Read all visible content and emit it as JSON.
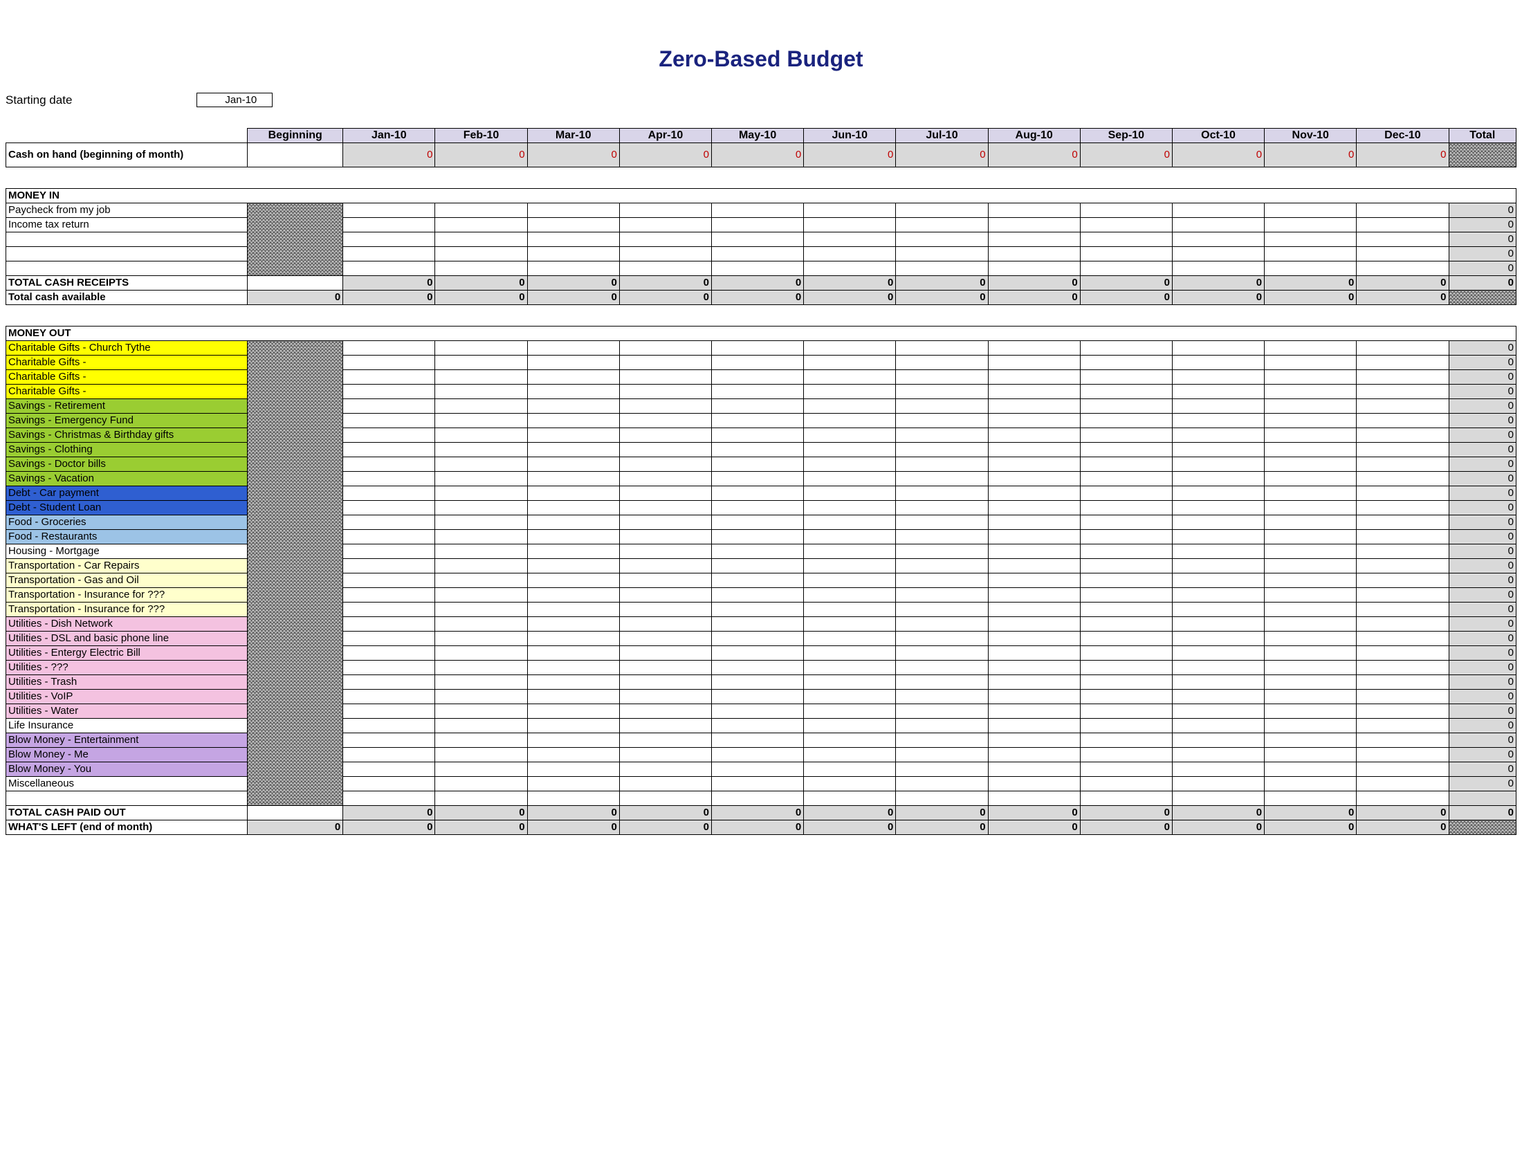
{
  "title": "Zero-Based Budget",
  "start_label": "Starting date",
  "start_value": "Jan-10",
  "columns": [
    "Beginning",
    "Jan-10",
    "Feb-10",
    "Mar-10",
    "Apr-10",
    "May-10",
    "Jun-10",
    "Jul-10",
    "Aug-10",
    "Sep-10",
    "Oct-10",
    "Nov-10",
    "Dec-10",
    "Total"
  ],
  "cash_on_hand_label": "Cash on hand (beginning of month)",
  "cash_on_hand_months": [
    0,
    0,
    0,
    0,
    0,
    0,
    0,
    0,
    0,
    0,
    0,
    0
  ],
  "money_in_label": "MONEY IN",
  "income_rows": [
    {
      "label": "Paycheck from my job",
      "total": 0
    },
    {
      "label": "Income tax return",
      "total": 0
    },
    {
      "label": "",
      "total": 0
    },
    {
      "label": "",
      "total": 0
    },
    {
      "label": "",
      "total": 0
    }
  ],
  "total_receipts_label": "TOTAL CASH RECEIPTS",
  "total_receipts_months": [
    0,
    0,
    0,
    0,
    0,
    0,
    0,
    0,
    0,
    0,
    0,
    0
  ],
  "total_receipts_total": 0,
  "total_available_label": "Total cash available",
  "total_available_beginning": 0,
  "total_available_months": [
    0,
    0,
    0,
    0,
    0,
    0,
    0,
    0,
    0,
    0,
    0,
    0
  ],
  "money_out_label": "MONEY OUT",
  "expense_rows": [
    {
      "label": "Charitable Gifts - Church Tythe",
      "color": "c-yellow",
      "total": 0
    },
    {
      "label": "Charitable Gifts -",
      "color": "c-yellow",
      "total": 0
    },
    {
      "label": "Charitable Gifts -",
      "color": "c-yellow",
      "total": 0
    },
    {
      "label": "Charitable Gifts -",
      "color": "c-yellow",
      "total": 0
    },
    {
      "label": "Savings - Retirement",
      "color": "c-green",
      "total": 0
    },
    {
      "label": "Savings - Emergency Fund",
      "color": "c-green",
      "total": 0
    },
    {
      "label": "Savings - Christmas & Birthday gifts",
      "color": "c-green",
      "total": 0
    },
    {
      "label": "Savings - Clothing",
      "color": "c-green",
      "total": 0
    },
    {
      "label": "Savings - Doctor bills",
      "color": "c-green",
      "total": 0
    },
    {
      "label": "Savings - Vacation",
      "color": "c-green",
      "total": 0
    },
    {
      "label": "Debt - Car payment",
      "color": "c-blue",
      "total": 0
    },
    {
      "label": "Debt - Student Loan",
      "color": "c-blue",
      "total": 0
    },
    {
      "label": "Food - Groceries",
      "color": "c-lblue",
      "total": 0
    },
    {
      "label": "Food - Restaurants",
      "color": "c-lblue",
      "total": 0
    },
    {
      "label": "Housing - Mortgage",
      "color": "c-white",
      "total": 0
    },
    {
      "label": "Transportation - Car Repairs",
      "color": "c-lyel",
      "total": 0
    },
    {
      "label": "Transportation - Gas and Oil",
      "color": "c-lyel",
      "total": 0
    },
    {
      "label": "Transportation - Insurance for ???",
      "color": "c-lyel",
      "total": 0
    },
    {
      "label": "Transportation - Insurance for ???",
      "color": "c-lyel",
      "total": 0
    },
    {
      "label": "Utilities - Dish Network",
      "color": "c-pink",
      "total": 0
    },
    {
      "label": "Utilities - DSL and basic phone line",
      "color": "c-pink",
      "total": 0
    },
    {
      "label": "Utilities - Entergy Electric Bill",
      "color": "c-pink",
      "total": 0
    },
    {
      "label": "Utilities - ???",
      "color": "c-pink",
      "total": 0
    },
    {
      "label": "Utilities - Trash",
      "color": "c-pink",
      "total": 0
    },
    {
      "label": "Utilities - VoIP",
      "color": "c-pink",
      "total": 0
    },
    {
      "label": "Utilities - Water",
      "color": "c-pink",
      "total": 0
    },
    {
      "label": "Life Insurance",
      "color": "c-white",
      "total": 0
    },
    {
      "label": "Blow Money - Entertainment",
      "color": "c-purp",
      "total": 0
    },
    {
      "label": "Blow Money - Me",
      "color": "c-purp",
      "total": 0
    },
    {
      "label": "Blow Money - You",
      "color": "c-purp",
      "total": 0
    },
    {
      "label": "Miscellaneous",
      "color": "c-white",
      "total": 0
    },
    {
      "label": "",
      "color": "c-white",
      "total": ""
    }
  ],
  "total_paid_label": "TOTAL CASH PAID OUT",
  "total_paid_months": [
    0,
    0,
    0,
    0,
    0,
    0,
    0,
    0,
    0,
    0,
    0,
    0
  ],
  "total_paid_total": 0,
  "whats_left_label": "WHAT'S LEFT (end of month)",
  "whats_left_beginning": 0,
  "whats_left_months": [
    0,
    0,
    0,
    0,
    0,
    0,
    0,
    0,
    0,
    0,
    0,
    0
  ]
}
